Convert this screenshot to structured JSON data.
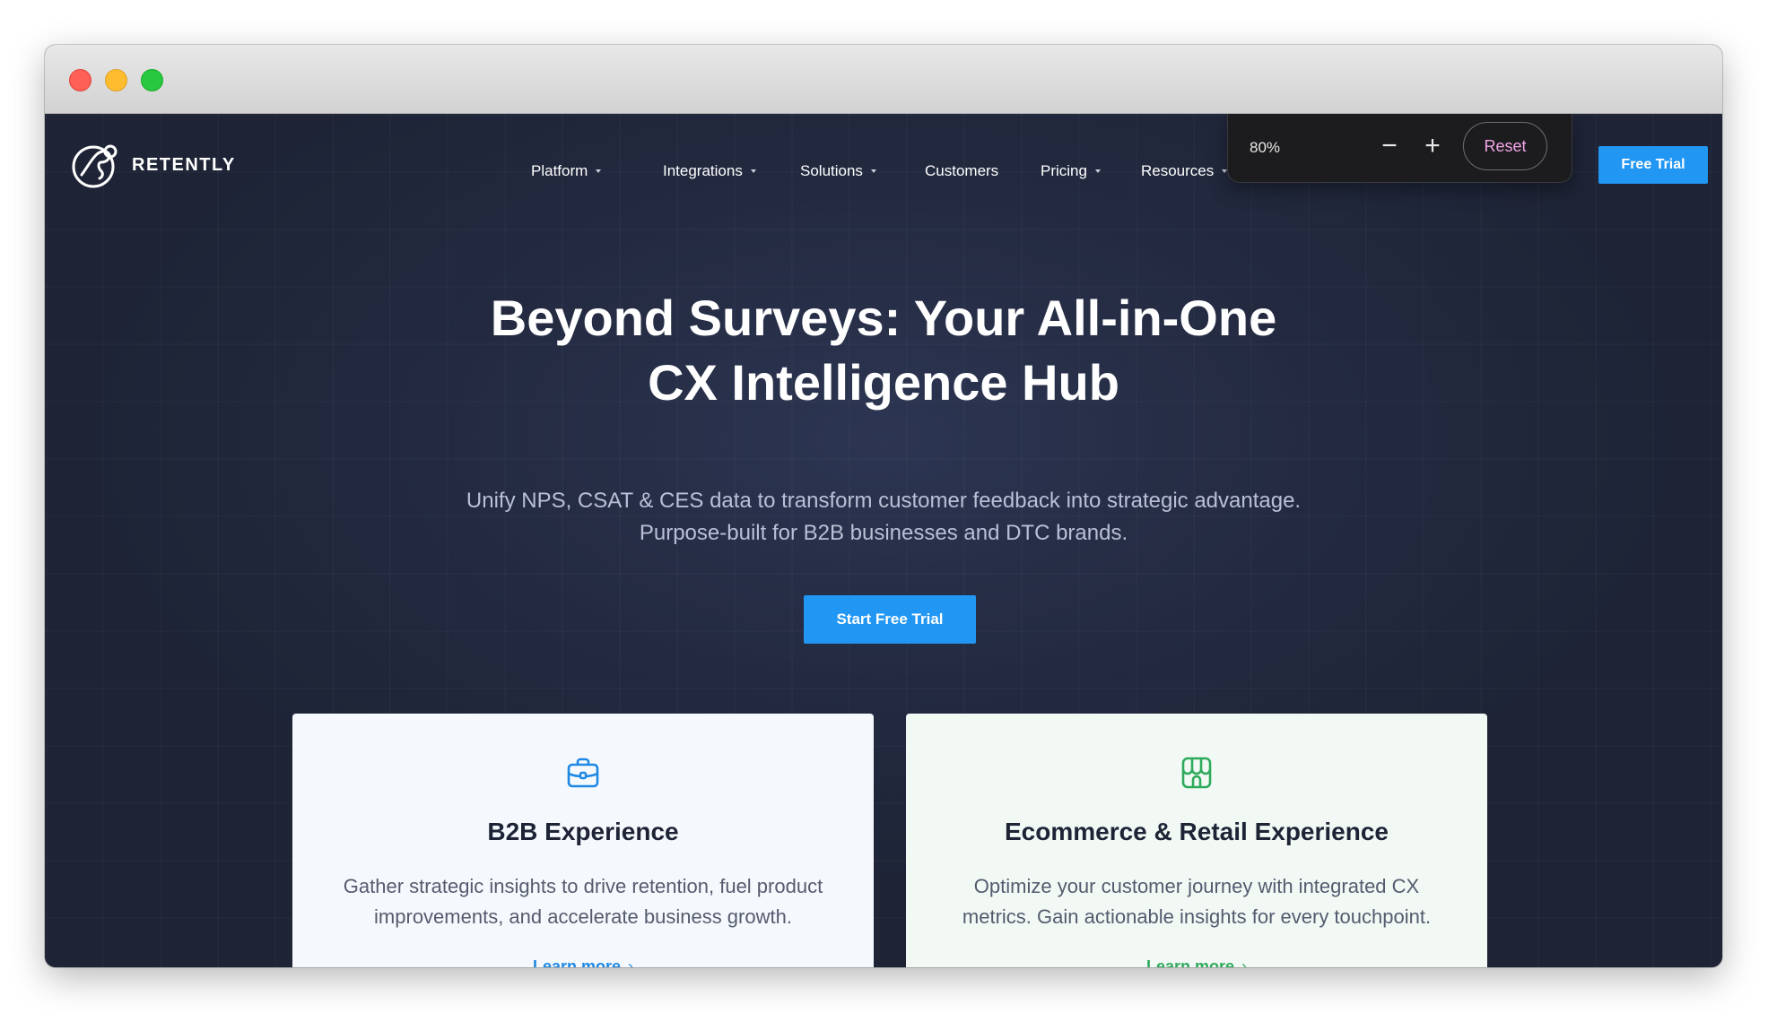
{
  "browser": {
    "zoom": {
      "level": "80%",
      "minus": "−",
      "plus": "+",
      "reset": "Reset"
    }
  },
  "nav": {
    "brand": "RETENTLY",
    "items": [
      {
        "label": "Platform",
        "dropdown": true
      },
      {
        "label": "Integrations",
        "dropdown": true
      },
      {
        "label": "Solutions",
        "dropdown": true
      },
      {
        "label": "Customers",
        "dropdown": false
      },
      {
        "label": "Pricing",
        "dropdown": true
      },
      {
        "label": "Resources",
        "dropdown": true
      }
    ],
    "cta": "Free Trial"
  },
  "hero": {
    "title_line1": "Beyond Surveys: Your All-in-One",
    "title_line2": "CX Intelligence Hub",
    "subtitle_line1": "Unify NPS, CSAT & CES data to transform customer feedback into strategic advantage.",
    "subtitle_line2": "Purpose-built for B2B businesses and DTC brands.",
    "cta": "Start Free Trial"
  },
  "cards": [
    {
      "icon": "briefcase-icon",
      "title": "B2B Experience",
      "desc_line1": "Gather strategic insights to drive retention, fuel product",
      "desc_line2": "improvements, and accelerate business growth.",
      "link": "Learn more",
      "accent": "#1e88e5"
    },
    {
      "icon": "storefront-icon",
      "title": "Ecommerce & Retail Experience",
      "desc_line1": "Optimize your customer journey with integrated CX",
      "desc_line2": "metrics. Gain actionable insights for every touchpoint.",
      "link": "Learn more",
      "accent": "#2eaa5c"
    }
  ],
  "colors": {
    "primary": "#2196f3",
    "page_bg": "#232a40"
  }
}
